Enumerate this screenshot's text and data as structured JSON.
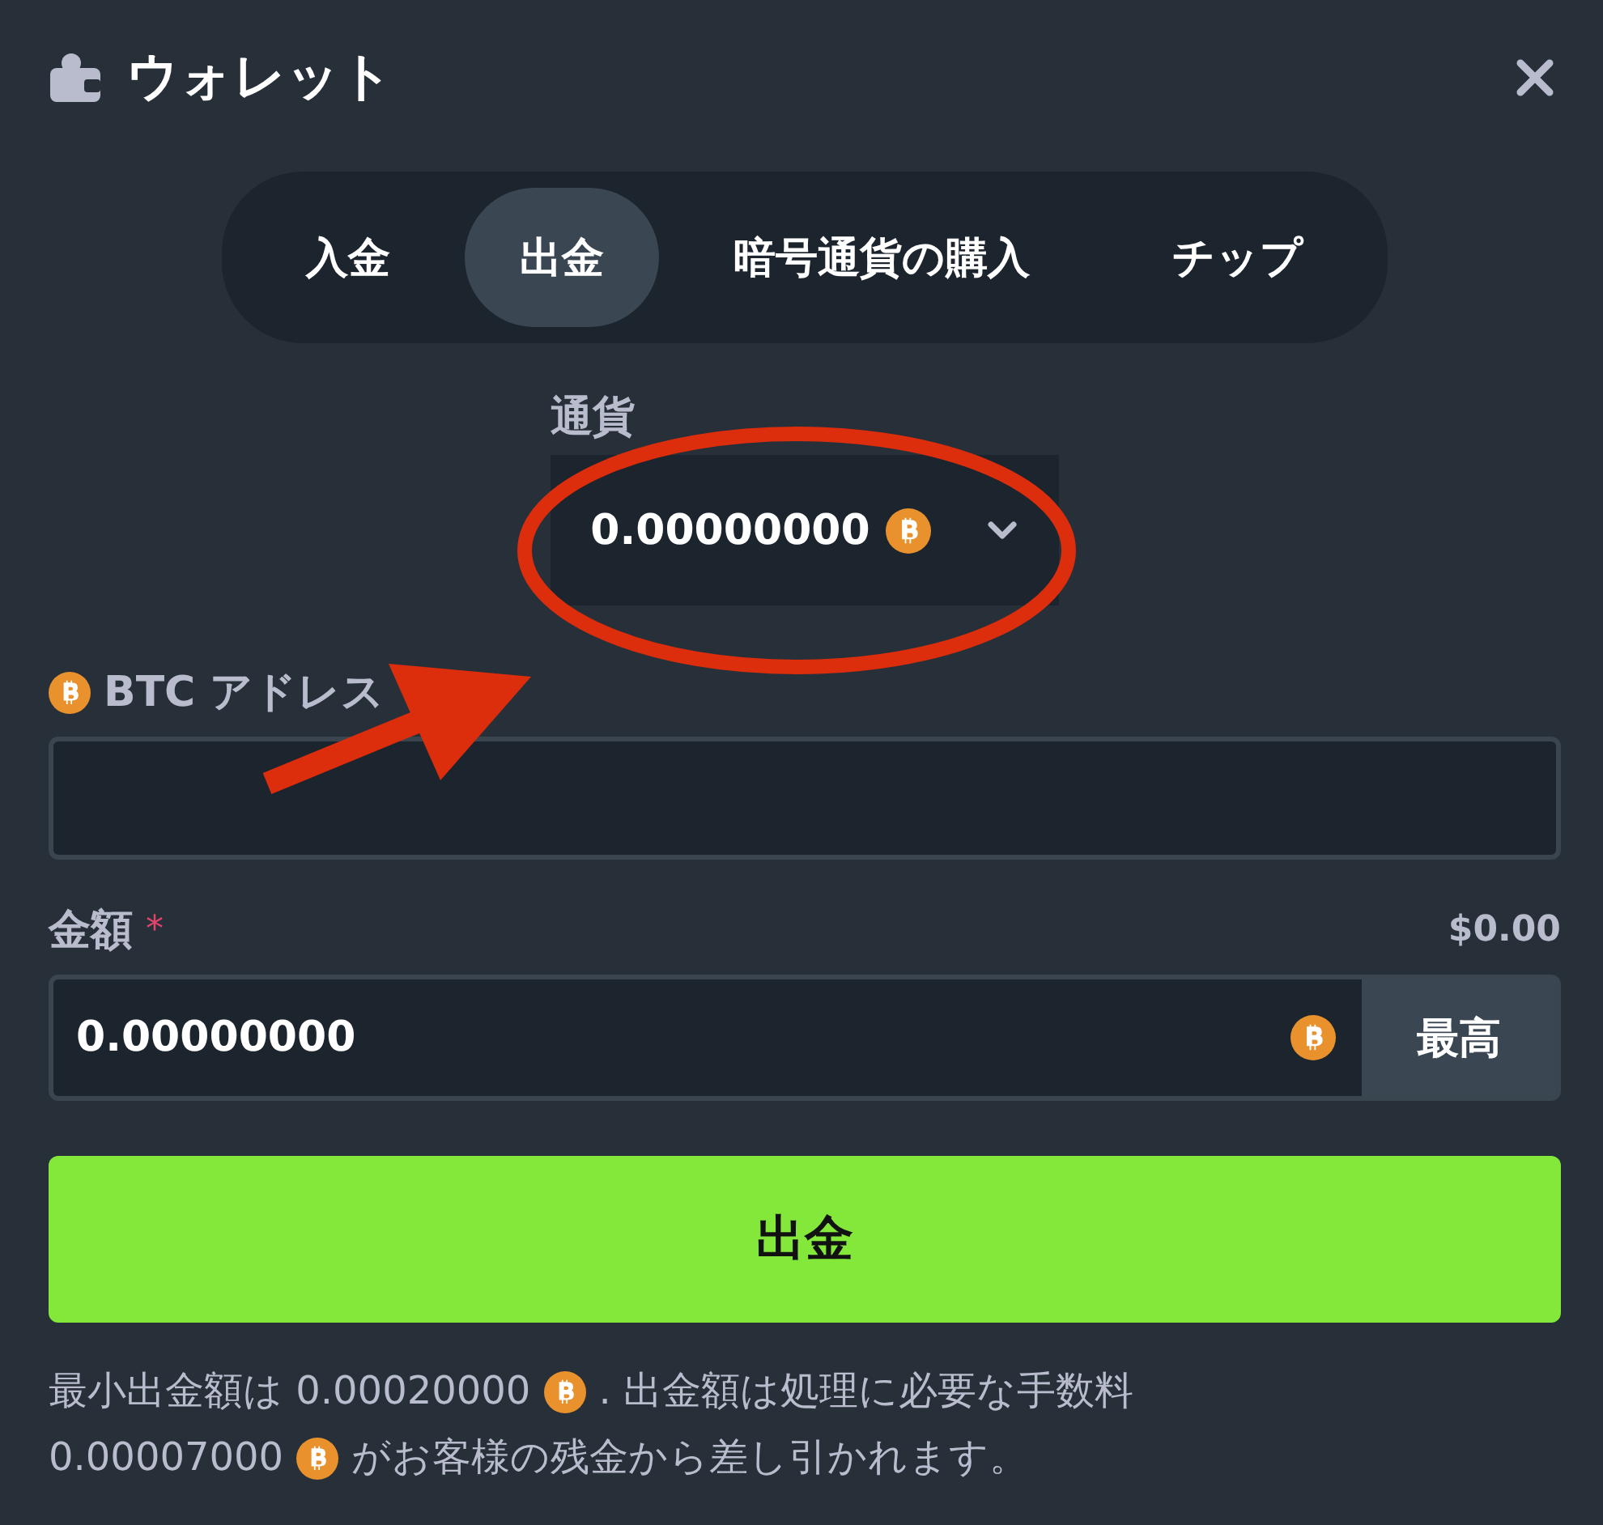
{
  "window": {
    "title": "ウォレット"
  },
  "tabs": [
    {
      "label": "入金",
      "selected": false
    },
    {
      "label": "出金",
      "selected": true
    },
    {
      "label": "暗号通貨の購入",
      "selected": false
    },
    {
      "label": "チップ",
      "selected": false
    }
  ],
  "currency": {
    "label": "通貨",
    "value": "0.00000000"
  },
  "address": {
    "label": "BTC アドレス"
  },
  "amount": {
    "label": "金額",
    "required_mark": "*",
    "usd": "$0.00",
    "value": "0.00000000",
    "max_label": "最高"
  },
  "submit": "出金",
  "note": {
    "lines": [
      [
        {
          "kind": "text",
          "text": "最小出金額は 0.00020000"
        },
        {
          "kind": "coin"
        },
        {
          "kind": "text",
          "text": ". 出金額は処理に必要な手数料"
        }
      ],
      [
        {
          "kind": "text",
          "text": "0.00007000"
        },
        {
          "kind": "coin"
        },
        {
          "kind": "text",
          "text": "がお客様の残金から差し引かれます。"
        }
      ]
    ]
  }
}
